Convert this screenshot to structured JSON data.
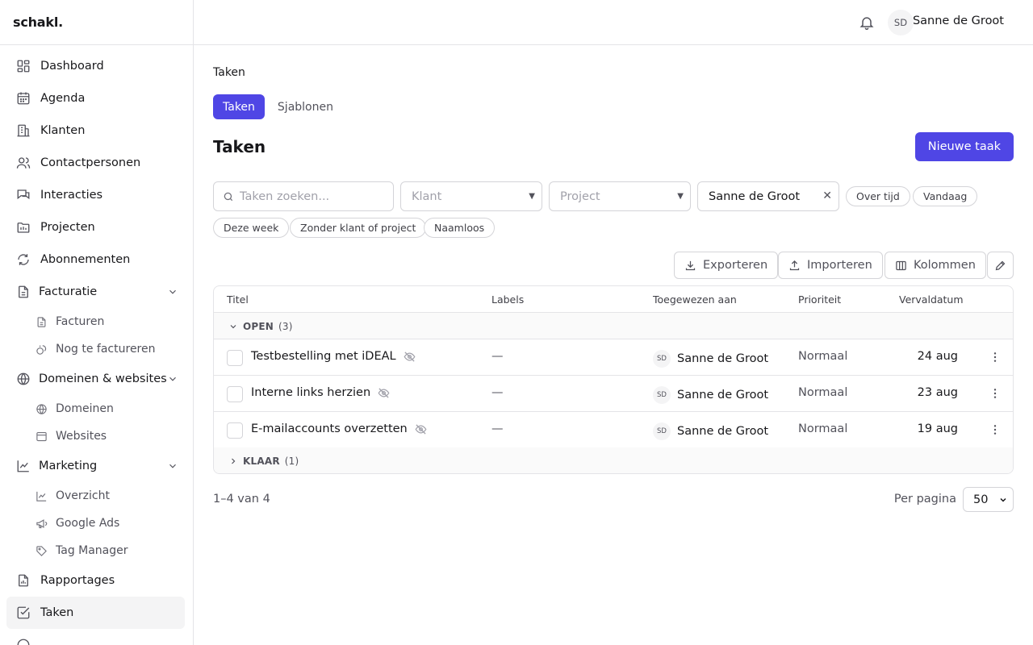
{
  "brand": "schakl.",
  "header": {
    "avatar_initials": "SD",
    "user_name": "Sanne de Groot"
  },
  "sidebar": {
    "dashboard": "Dashboard",
    "agenda": "Agenda",
    "klanten": "Klanten",
    "contactpersonen": "Contactpersonen",
    "interacties": "Interacties",
    "projecten": "Projecten",
    "abonnementen": "Abonnementen",
    "facturatie": "Facturatie",
    "facturen": "Facturen",
    "nog_te_factureren": "Nog te factureren",
    "domeinen_websites": "Domeinen & websites",
    "domeinen": "Domeinen",
    "websites": "Websites",
    "marketing": "Marketing",
    "overzicht": "Overzicht",
    "google_ads": "Google Ads",
    "tag_manager": "Tag Manager",
    "rapportages": "Rapportages",
    "taken": "Taken"
  },
  "main": {
    "breadcrumb": "Taken",
    "tabs": [
      "Taken",
      "Sjablonen"
    ],
    "title": "Taken",
    "new_button": "Nieuwe taak",
    "filters": {
      "search_placeholder": "Taken zoeken...",
      "klant": "Klant",
      "project": "Project",
      "assignee": "Sanne de Groot",
      "chips": [
        "Over tijd",
        "Vandaag",
        "Deze week",
        "Zonder klant of project",
        "Naamloos"
      ]
    },
    "toolbar": {
      "export": "Exporteren",
      "import": "Importeren",
      "columns": "Kolommen"
    },
    "table": {
      "columns": [
        "Titel",
        "Labels",
        "Toegewezen aan",
        "Prioriteit",
        "Vervaldatum"
      ],
      "groups": [
        {
          "name": "OPEN",
          "count": "(3)"
        },
        {
          "name": "KLAAR",
          "count": "(1)"
        }
      ],
      "rows": [
        {
          "title": "Testbestelling met iDEAL",
          "labels": "—",
          "initials": "SD",
          "assignee": "Sanne de Groot",
          "priority": "Normaal",
          "due": "24 aug"
        },
        {
          "title": "Interne links herzien",
          "labels": "—",
          "initials": "SD",
          "assignee": "Sanne de Groot",
          "priority": "Normaal",
          "due": "23 aug"
        },
        {
          "title": "E-mailaccounts overzetten",
          "labels": "—",
          "initials": "SD",
          "assignee": "Sanne de Groot",
          "priority": "Normaal",
          "due": "19 aug"
        }
      ]
    },
    "footer": {
      "count": "1–4 van 4",
      "per_page_label": "Per pagina",
      "per_page_value": "50"
    }
  }
}
